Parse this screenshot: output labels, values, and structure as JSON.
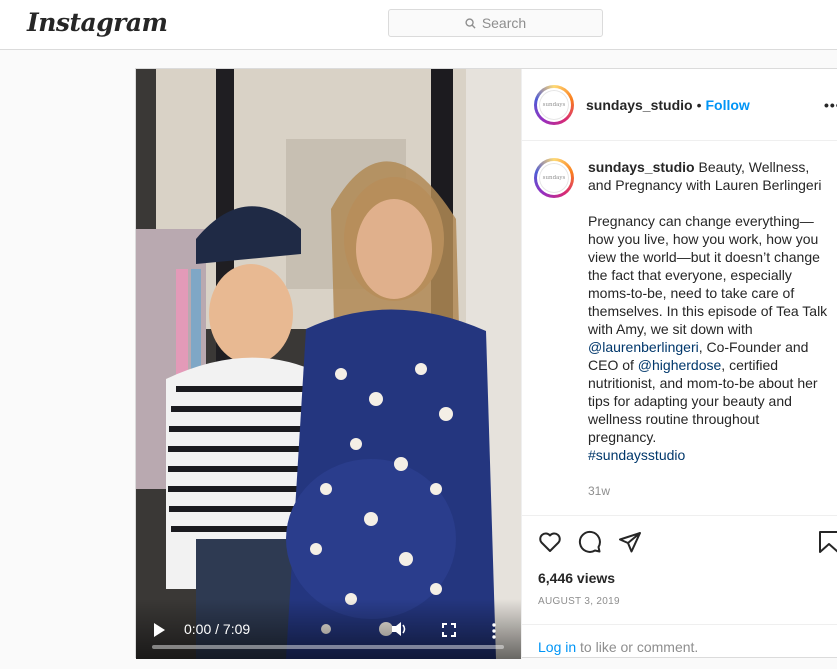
{
  "app": {
    "logo": "Instagram"
  },
  "search": {
    "placeholder": "Search"
  },
  "video": {
    "time": "0:00 / 7:09"
  },
  "post": {
    "username": "sundays_studio",
    "avatar_text": "sundays",
    "follow_label": "Follow",
    "dot": "•",
    "more_label": "•••",
    "caption_title": "Beauty, Wellness, and Pregnancy with Lauren Berlingeri",
    "caption_body_1": "Pregnancy can change everything—how you live, how you work, how you view the world—but it doesn’t change the fact that everyone, especially moms-to-be, need to take care of themselves. In this episode of Tea Talk with Amy, we sit down with",
    "mention_1": "@laurenberlingeri",
    "caption_body_2": ", Co-Founder and CEO of",
    "mention_2": "@higherdose",
    "caption_body_3": ", certified nutritionist, and mom-to-be about her tips for adapting your beauty and wellness routine throughout pregnancy.",
    "hashtag": "#sundaysstudio",
    "age": "31w",
    "views": "6,446 views",
    "date": "AUGUST 3, 2019",
    "login_link": "Log in",
    "login_rest": " to like or comment."
  },
  "colors": {
    "link": "#0095f6",
    "mention": "#00376b",
    "text": "#262626",
    "muted": "#8e8e8e"
  }
}
